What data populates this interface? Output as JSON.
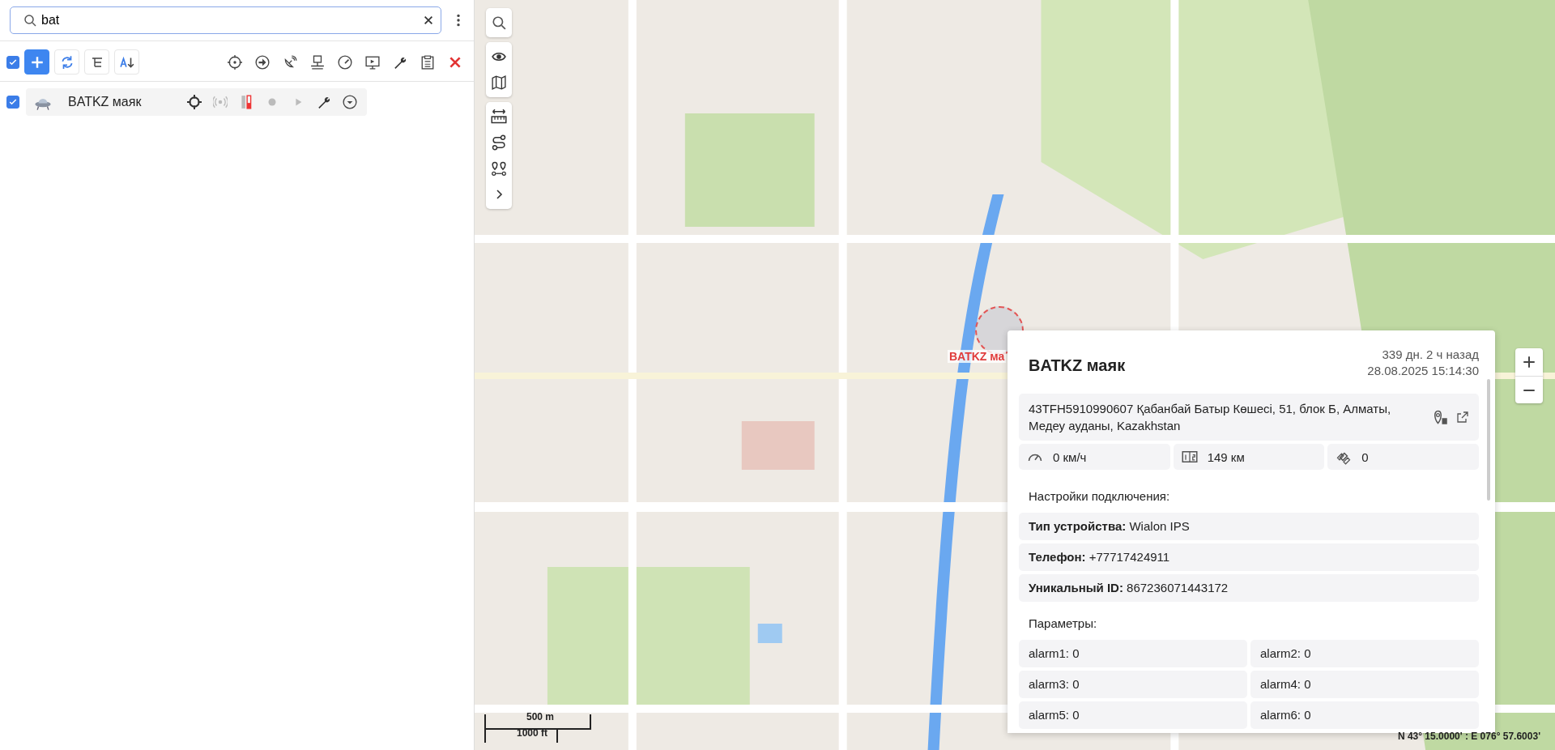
{
  "search": {
    "value": "bat"
  },
  "toolbar": {
    "select_all": {
      "checked": true
    }
  },
  "units": [
    {
      "name": "BATKZ маяк",
      "checked": true
    }
  ],
  "marker": {
    "label": "BATKZ ма"
  },
  "popup": {
    "title": "BATKZ маяк",
    "ago": "339 дн. 2 ч назад",
    "time": "28.08.2025 15:14:30",
    "address": "43TFH5910990607 Қабанбай Батыр Көшесі, 51, блок Б, Алматы, Медеу ауданы, Kazakhstan",
    "stats": [
      {
        "kind": "speed",
        "value": "0 км/ч"
      },
      {
        "kind": "mileage",
        "value": "149 км"
      },
      {
        "kind": "satellites",
        "value": "0"
      }
    ],
    "connection_heading": "Настройки подключения:",
    "connection": [
      "**Тип устройства:** Wialon IPS",
      "**Телефон:** +77717424911",
      "**Уникальный ID:** 867236071443172"
    ],
    "params_heading": "Параметры:",
    "params": [
      "alarm1: 0",
      "alarm2: 0",
      "alarm3: 0",
      "alarm4: 0",
      "alarm5: 0",
      "alarm6: 0"
    ]
  },
  "scale": {
    "metric": "500 m",
    "imperial": "1000 ft"
  },
  "coordinates": "N 43° 15.0000' : E 076° 57.6003'"
}
